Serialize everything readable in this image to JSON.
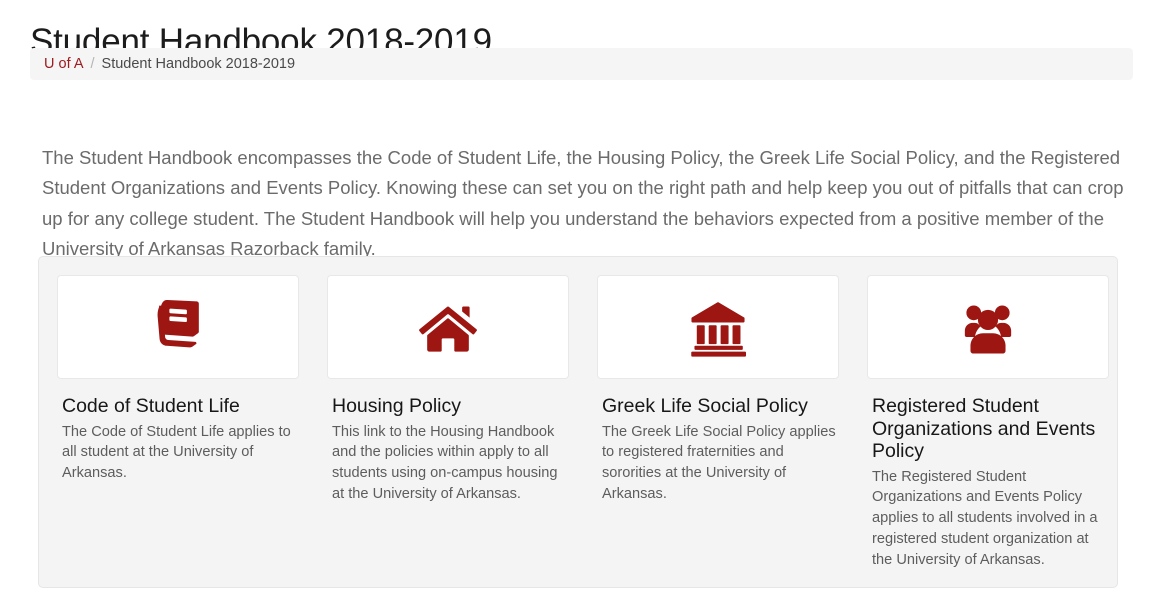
{
  "page_title": "Student Handbook 2018-2019",
  "breadcrumb": {
    "home_label": "U of A",
    "separator": "/",
    "current_label": "Student Handbook 2018-2019"
  },
  "intro": "The Student Handbook encompasses the Code of Student Life, the Housing Policy, the Greek Life Social Policy, and the Registered Student Organizations and Events Policy. Knowing these can set you on the right path and help keep you out of pitfalls that can crop up for any college student. The Student Handbook will help you understand the behaviors expected from a positive member of the University of Arkansas Razorback family.",
  "theme": {
    "accent_red": "#9d1612",
    "link_red": "#9d1c20",
    "panel_background": "#f4f4f4",
    "breadcrumb_background": "#f5f5f5",
    "body_text": "#6b6b6b",
    "title_text": "#1c1c1c"
  },
  "cards": [
    {
      "icon": "book-icon",
      "title": "Code of Student Life",
      "description": "The Code of Student Life applies to all student at the University of Arkansas."
    },
    {
      "icon": "home-icon",
      "title": "Housing Policy",
      "description": "This link to the Housing Handbook and the policies within apply to all students using on-campus housing at the University of Arkansas."
    },
    {
      "icon": "bank-icon",
      "title": "Greek Life Social Policy",
      "description": "The Greek Life Social Policy applies to registered fraternities and sororities at the University of Arkansas."
    },
    {
      "icon": "users-icon",
      "title": "Registered Student Organizations and Events Policy",
      "description": "The Registered Student Organizations and Events Policy applies to all students involved in a registered student organization at the University of Arkansas."
    }
  ]
}
